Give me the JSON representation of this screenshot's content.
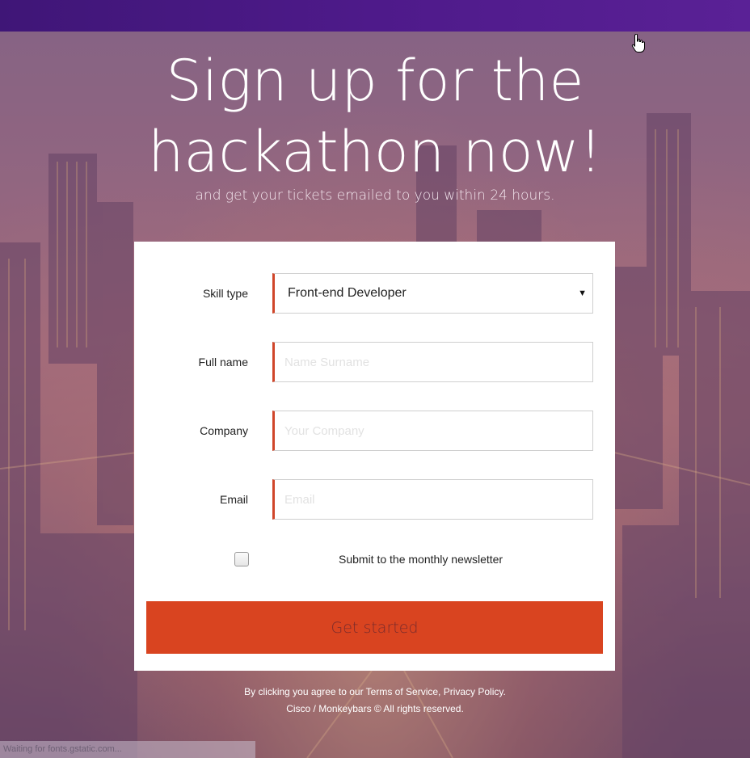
{
  "headline": {
    "line1": "Sign up for the",
    "line2": "hackathon now!"
  },
  "subheadline": "and get your tickets emailed to you within 24 hours.",
  "form": {
    "skill_type": {
      "label": "Skill type",
      "selected": "Front-end Developer"
    },
    "full_name": {
      "label": "Full name",
      "placeholder": "Name Surname"
    },
    "company": {
      "label": "Company",
      "placeholder": "Your Company"
    },
    "email": {
      "label": "Email",
      "placeholder": "Email"
    },
    "newsletter": {
      "label": "Submit to the monthly newsletter",
      "checked": false
    },
    "submit_label": "Get started"
  },
  "footer": {
    "line1": "By clicking you agree to our Terms of Service, Privacy Policy.",
    "line2": "Cisco / Monkeybars © All rights reserved."
  },
  "status_bar": "Waiting for fonts.gstatic.com...",
  "colors": {
    "top_bar": "#4e1a8a",
    "accent": "#d94420",
    "field_border_accent": "#d0462a"
  },
  "icons": {
    "select_arrow": "triangle-down-icon",
    "cursor": "hand-pointer-icon"
  }
}
